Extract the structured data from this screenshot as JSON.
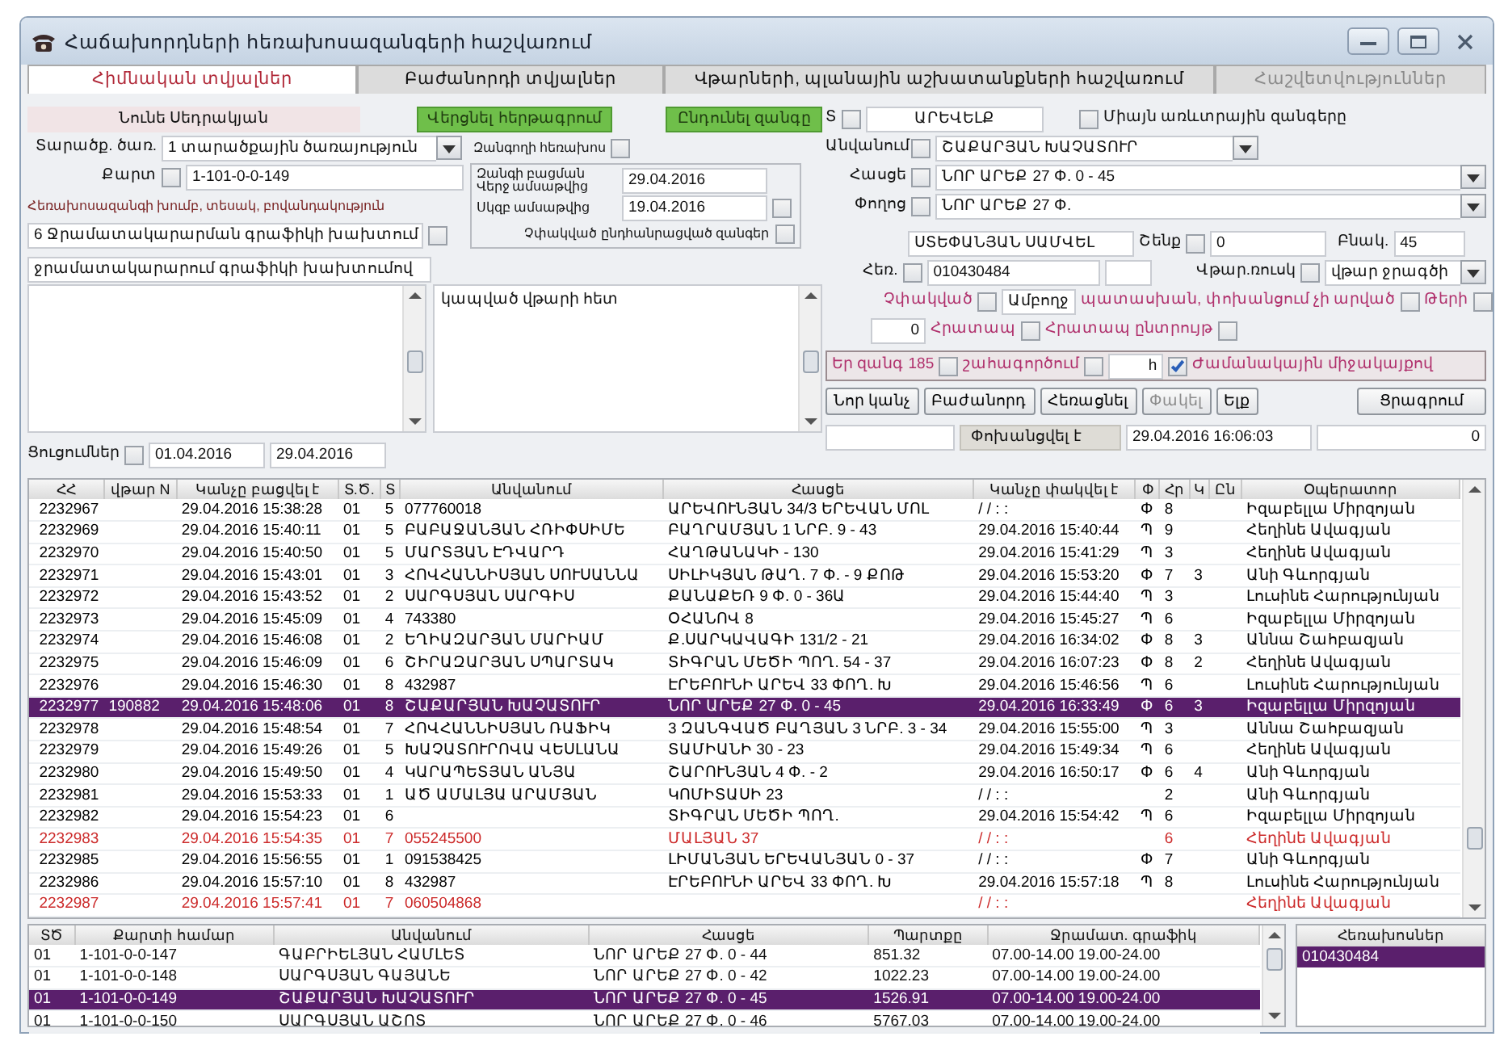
{
  "window": {
    "title": "Հաճախորդների հեռախոսազանգերի հաշվառում"
  },
  "tabs": [
    {
      "label": "Հիմնական տվյալներ",
      "selected": true,
      "disabled": false
    },
    {
      "label": "Բաժանորդի տվյալներ",
      "selected": false,
      "disabled": false
    },
    {
      "label": "Վթարների, պլանային աշխատանքների հաշվառում",
      "selected": false,
      "disabled": false
    },
    {
      "label": "Հաշվետվություններ",
      "selected": false,
      "disabled": true
    }
  ],
  "operator": "Նունե Սեդրակյան",
  "action_buttons": [
    "Վերցնել հերթագրում",
    "Ընդունել զանգը"
  ],
  "region": {
    "label": "Տ",
    "checked": false,
    "value": "ԱՐԵՎԵԼՔ"
  },
  "only_commercial": {
    "label": "Միայն առևտրային զանգերը",
    "checked": false
  },
  "service_area": {
    "label": "Տարածք. ծառ.",
    "value": "1 տարածքային ծառայություն"
  },
  "caller_phone": {
    "label": "Զանգողի հեռախոս",
    "checked": false
  },
  "card": {
    "label": "Քարտ",
    "checked": false,
    "value": "1-101-0-0-149"
  },
  "call_opening": {
    "title": "Զանգի բացման",
    "to_label": "Վերջ ամսաթվից",
    "to": "29.04.2016",
    "from_label": "Սկզբ ամսաթվից",
    "from": "19.04.2016",
    "checked": false,
    "unclosed_label": "Չփակված ընդհանրացված զանգեր",
    "unclosed_checked": false
  },
  "group_label": "Հեռախոսազանգի խումբ, տեսակ, բովանդակություն",
  "group": {
    "value": "6 Ջրամատակարարման գրաֆիկի խախտում",
    "checked": false
  },
  "subgroup": "ջրամատակարարում գրաֆիկի խախտումով",
  "note": "կապված վթարի հետ",
  "indications": {
    "label": "Ցուցումներ",
    "checked": false,
    "from": "01.04.2016",
    "to": "29.04.2016"
  },
  "lookups": [
    {
      "label": "Անվանում",
      "checked": false,
      "value": "ՇԱՔԱՐՅԱՆ ԽԱՉԱՏՈՒՐ"
    },
    {
      "label": "Հասցե",
      "checked": false,
      "value": "ՆՈՐ ԱՐԵՔ 27 Փ. 0 - 45"
    },
    {
      "label": "Փողոց",
      "checked": false,
      "value": "ՆՈՐ ԱՐԵՔ 27 Փ."
    }
  ],
  "subscriber": "ՍՏԵՓԱՆՅԱՆ ՍԱՄՎԵԼ",
  "building": {
    "label": "Շենք",
    "checked": false,
    "value": "0"
  },
  "apartment": {
    "label": "Բնակ.",
    "value": "45"
  },
  "phone": {
    "label": "Հեռ.",
    "checked": false,
    "value": "010430484"
  },
  "accident": {
    "label": "Վթար.ռուսկ",
    "checked": false,
    "value": "վթար ջրագծի"
  },
  "flags": [
    {
      "kind": "label_check",
      "label": "Չփակված",
      "checked": false
    },
    {
      "kind": "field",
      "value": "Ամբողջ"
    },
    {
      "kind": "label_check",
      "label": "պատասխան, փոխանցում չի արված",
      "checked": false
    },
    {
      "kind": "label_check",
      "label": "Թերի",
      "checked": false
    }
  ],
  "urgency": [
    {
      "kind": "field",
      "value": "0"
    },
    {
      "kind": "label_check",
      "label": "Հրատապ",
      "checked": false
    },
    {
      "kind": "label_check",
      "label": "Հրատապ ընտրույթ",
      "checked": false
    }
  ],
  "options": [
    {
      "kind": "label_check",
      "label": "Եր զանգ 185",
      "checked": false
    },
    {
      "kind": "label_check",
      "label": "շահագործում",
      "checked": false
    },
    {
      "kind": "field",
      "value": "h"
    },
    {
      "kind": "check_label",
      "label": "Ժամանակային միջակայքով",
      "checked": true
    }
  ],
  "buttons": [
    {
      "label": "Նոր կանչ",
      "disabled": false
    },
    {
      "label": "Բաժանորդ",
      "disabled": false
    },
    {
      "label": "Հեռացնել",
      "disabled": false
    },
    {
      "label": "Փակել",
      "disabled": true
    },
    {
      "label": "Ելք",
      "disabled": false
    }
  ],
  "print_button": "Ցրագրում",
  "transfer": {
    "label": "Փոխանցվել է",
    "time": "29.04.2016 16:06:03",
    "count": "0"
  },
  "calls": {
    "columns": [
      "ՀՀ",
      "վթար N",
      "Կանչը բացվել է",
      "Տ.Ծ.",
      "Տ",
      "Անվանում",
      "Հասցե",
      "Կանչը փակվել է",
      "Փ",
      "Հր",
      "Կ",
      "Ըն",
      "Օպերատոր"
    ],
    "rows": [
      {
        "selected": false,
        "color": "#000000",
        "cells": [
          "2232967",
          "",
          "29.04.2016 15:38:28",
          "01",
          "5",
          "077760018",
          "ԱՐԵՎՈՒՆՅԱՆ 34/3 ԵՐԵՎԱՆ ՄՈԼ",
          "/ /   : :",
          "Փ",
          "8",
          "",
          "",
          "Իզաբելլա Միրզոյան"
        ]
      },
      {
        "selected": false,
        "color": "#000000",
        "cells": [
          "2232969",
          "",
          "29.04.2016 15:40:11",
          "01",
          "5",
          "ԲԱԲԱՋԱՆՅԱՆ ՀՌԻՓՍԻՄԵ",
          "ԲԱՂՐԱՄՅԱՆ 1 ՆՐԲ. 9 - 43",
          "29.04.2016 15:40:44",
          "Պ",
          "9",
          "",
          "",
          "Հեղինե Ավագյան"
        ]
      },
      {
        "selected": false,
        "color": "#000000",
        "cells": [
          "2232970",
          "",
          "29.04.2016 15:40:50",
          "01",
          "5",
          "ՄԱՐՏՅԱՆ ԷԴՎԱՐԴ",
          "ՀԱՂԹԱՆԱԿԻ - 130",
          "29.04.2016 15:41:29",
          "Պ",
          "3",
          "",
          "",
          "Հեղինե Ավագյան"
        ]
      },
      {
        "selected": false,
        "color": "#000000",
        "cells": [
          "2232971",
          "",
          "29.04.2016 15:43:01",
          "01",
          "3",
          "ՀՈՎՀԱՆՆԻՍՅԱՆ ՍՈՒՍԱՆՆԱ",
          "ՍԻԼԻԿՅԱՆ ԹԱՂ. 7 Փ. - 9 ՔՈԹ",
          "29.04.2016 15:53:20",
          "Փ",
          "7",
          "3",
          "",
          "Անի Գևորգյան"
        ]
      },
      {
        "selected": false,
        "color": "#000000",
        "cells": [
          "2232972",
          "",
          "29.04.2016 15:43:52",
          "01",
          "2",
          "ՍԱՐԳՍՅԱՆ ՍԱՐԳԻՍ",
          "ՔԱՆԱՔԵՌ 9 Փ. 0 - 36Ա",
          "29.04.2016 15:44:40",
          "Պ",
          "3",
          "",
          "",
          "Լուսինե Հարությունյան"
        ]
      },
      {
        "selected": false,
        "color": "#000000",
        "cells": [
          "2232973",
          "",
          "29.04.2016 15:45:09",
          "01",
          "4",
          "743380",
          "ՕՀԱՆՈՎ 8",
          "29.04.2016 15:45:27",
          "Պ",
          "6",
          "",
          "",
          "Իզաբելլա Միրզոյան"
        ]
      },
      {
        "selected": false,
        "color": "#000000",
        "cells": [
          "2232974",
          "",
          "29.04.2016 15:46:08",
          "01",
          "2",
          "ԵՂԻԱԶԱՐՅԱՆ ՄԱՐԻԱՄ",
          "Ք.ՍԱՐԿԱՎԱԳԻ 131/2 - 21",
          "29.04.2016 16:34:02",
          "Փ",
          "8",
          "3",
          "",
          "Աննա Շահբազյան"
        ]
      },
      {
        "selected": false,
        "color": "#000000",
        "cells": [
          "2232975",
          "",
          "29.04.2016 15:46:09",
          "01",
          "6",
          "ՇԻՐԱԶԱՐՅԱՆ ՍՊԱՐՏԱԿ",
          "ՏԻԳՐԱՆ ՄԵԾԻ ՊՈՂ. 54 - 37",
          "29.04.2016 16:07:23",
          "Փ",
          "8",
          "2",
          "",
          "Հեղինե Ավագյան"
        ]
      },
      {
        "selected": false,
        "color": "#000000",
        "cells": [
          "2232976",
          "",
          "29.04.2016 15:46:30",
          "01",
          "8",
          "432987",
          "ԷՐԵԲՈՒՆԻ ԱՐԵՎ 33 ՓՈՂ. Խ",
          "29.04.2016 15:46:56",
          "Պ",
          "6",
          "",
          "",
          "Լուսինե Հարությունյան"
        ]
      },
      {
        "selected": true,
        "cells": [
          "2232977",
          "190882",
          "29.04.2016 15:48:06",
          "01",
          "8",
          "ՇԱՔԱՐՅԱՆ ԽԱՉԱՏՈՒՐ",
          "ՆՈՐ ԱՐԵՔ 27 Փ. 0 - 45",
          "29.04.2016 16:33:49",
          "Փ",
          "6",
          "3",
          "",
          "Իզաբելլա Միրզոյան"
        ]
      },
      {
        "selected": false,
        "color": "#000000",
        "cells": [
          "2232978",
          "",
          "29.04.2016 15:48:54",
          "01",
          "7",
          "ՀՈՎՀԱՆՆԻՍՅԱՆ ՌԱՖԻԿ",
          "3 ԶԱՆԳՎԱԾ ԲԱՂՅԱՆ 3 ՆՐԲ. 3 - 34",
          "29.04.2016 15:55:00",
          "Պ",
          "3",
          "",
          "",
          "Աննա Շահբազյան"
        ]
      },
      {
        "selected": false,
        "color": "#000000",
        "cells": [
          "2232979",
          "",
          "29.04.2016 15:49:26",
          "01",
          "5",
          "ԽԱՉԱՏՈՒՐՈՎԱ ՎԵՍԼԱՆԱ",
          "ՏԱՄԻԱՆԻ 30 - 23",
          "29.04.2016 15:49:34",
          "Պ",
          "6",
          "",
          "",
          "Հեղինե Ավագյան"
        ]
      },
      {
        "selected": false,
        "color": "#000000",
        "cells": [
          "2232980",
          "",
          "29.04.2016 15:49:50",
          "01",
          "4",
          "ԿԱՐԱՊԵՏՅԱՆ ԱՆՅԱ",
          "ՇԱՐՈՒՆՅԱՆ 4 Փ. - 2",
          "29.04.2016 16:50:17",
          "Փ",
          "6",
          "4",
          "",
          "Անի Գևորգյան"
        ]
      },
      {
        "selected": false,
        "color": "#000000",
        "cells": [
          "2232981",
          "",
          "29.04.2016 15:53:33",
          "01",
          "1",
          "ԱԾ ԱՄԱԼՅԱ ԱՐԱՄՅԱՆ",
          "ԿՈՄԻՏԱՍԻ 23",
          "/ /   : :",
          "",
          "2",
          "",
          "",
          "Անի Գևորգյան"
        ]
      },
      {
        "selected": false,
        "color": "#000000",
        "cells": [
          "2232982",
          "",
          "29.04.2016 15:54:23",
          "01",
          "6",
          "",
          "ՏԻԳՐԱՆ ՄԵԾԻ ՊՈՂ.",
          "29.04.2016 15:54:42",
          "Պ",
          "6",
          "",
          "",
          "Իզաբելլա Միրզոյան"
        ]
      },
      {
        "selected": false,
        "color": "#cc2a2a",
        "cells": [
          "2232983",
          "",
          "29.04.2016 15:54:35",
          "01",
          "7",
          "055245500",
          "ՄԱԼՅԱՆ 37",
          "/ /   : :",
          "",
          "6",
          "",
          "",
          "Հեղինե Ավագյան"
        ]
      },
      {
        "selected": false,
        "color": "#000000",
        "cells": [
          "2232985",
          "",
          "29.04.2016 15:56:55",
          "01",
          "1",
          "091538425",
          "ԼԻՄԱՆՅԱՆ ԵՐԵՎԱՆՅԱՆ 0 - 37",
          "/ /   : :",
          "Փ",
          "7",
          "",
          "",
          "Անի Գևորգյան"
        ]
      },
      {
        "selected": false,
        "color": "#000000",
        "cells": [
          "2232986",
          "",
          "29.04.2016 15:57:10",
          "01",
          "8",
          "432987",
          "ԷՐԵԲՈՒՆԻ ԱՐԵՎ 33 ՓՈՂ. Խ",
          "29.04.2016 15:57:18",
          "Պ",
          "8",
          "",
          "",
          "Լուսինե Հարությունյան"
        ]
      },
      {
        "selected": false,
        "color": "#cc2a2a",
        "cells": [
          "2232987",
          "",
          "29.04.2016 15:57:41",
          "01",
          "7",
          "060504868",
          "",
          "/ /   : :",
          "",
          "",
          "",
          "",
          "Հեղինե Ավագյան"
        ]
      }
    ]
  },
  "accounts": {
    "columns": [
      "ՏԾ",
      "Քարտի համար",
      "Անվանում",
      "Հասցե",
      "Պարտքը",
      "Ջրամատ. գրաֆիկ"
    ],
    "rows": [
      {
        "selected": false,
        "cells": [
          "01",
          "1-101-0-0-147",
          "ԳԱԲՐԻԵԼՅԱՆ ՀԱՄԼԵՏ",
          "ՆՈՐ ԱՐԵՔ 27 Փ. 0 - 44",
          "851.32",
          "07.00-14.00 19.00-24.00"
        ]
      },
      {
        "selected": false,
        "cells": [
          "01",
          "1-101-0-0-148",
          "ՍԱՐԳՍՅԱՆ ԳԱՅԱՆԵ",
          "ՆՈՐ ԱՐԵՔ 27 Փ. 0 - 42",
          "1022.23",
          "07.00-14.00 19.00-24.00"
        ]
      },
      {
        "selected": true,
        "cells": [
          "01",
          "1-101-0-0-149",
          "ՇԱՔԱՐՅԱՆ ԽԱՉԱՏՈՒՐ",
          "ՆՈՐ ԱՐԵՔ 27 Փ. 0 - 45",
          "1526.91",
          "07.00-14.00 19.00-24.00"
        ]
      },
      {
        "selected": false,
        "cells": [
          "01",
          "1-101-0-0-150",
          "ՍԱՐԳՍՅԱՆ ԱՇՈՏ",
          "ՆՈՐ ԱՐԵՔ 27 Փ. 0 - 46",
          "5767.03",
          "07.00-14.00 19.00-24.00"
        ]
      }
    ]
  },
  "phones": {
    "title": "Հեռախոսներ",
    "items": [
      {
        "value": "010430484",
        "selected": true
      }
    ]
  }
}
